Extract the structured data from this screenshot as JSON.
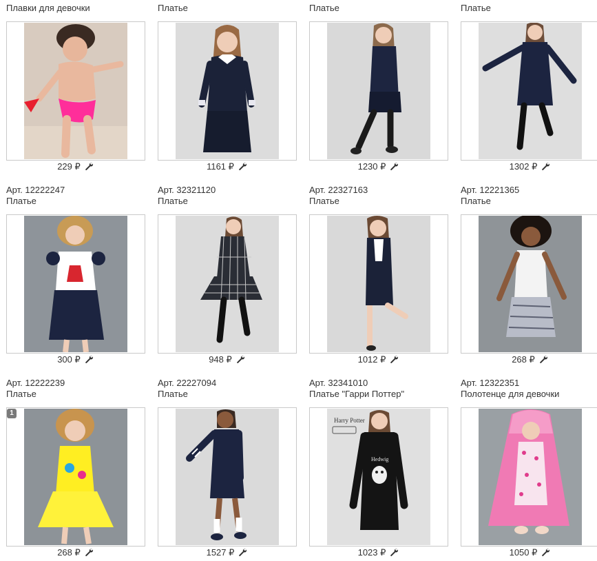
{
  "products": [
    {
      "art": "",
      "title": "Плавки для девочки",
      "price": "229 ₽",
      "badge": ""
    },
    {
      "art": "",
      "title": "Платье",
      "price": "1161 ₽",
      "badge": ""
    },
    {
      "art": "",
      "title": "Платье",
      "price": "1230 ₽",
      "badge": ""
    },
    {
      "art": "",
      "title": "Платье",
      "price": "1302 ₽",
      "badge": ""
    },
    {
      "art": "Арт. 12222247",
      "title": "Платье",
      "price": "300 ₽",
      "badge": ""
    },
    {
      "art": "Арт. 32321120",
      "title": "Платье",
      "price": "948 ₽",
      "badge": ""
    },
    {
      "art": "Арт. 22327163",
      "title": "Платье",
      "price": "1012 ₽",
      "badge": ""
    },
    {
      "art": "Арт. 12221365",
      "title": "Платье",
      "price": "268 ₽",
      "badge": ""
    },
    {
      "art": "Арт. 12222239",
      "title": "Платье",
      "price": "268 ₽",
      "badge": "1"
    },
    {
      "art": "Арт. 22227094",
      "title": "Платье",
      "price": "1527 ₽",
      "badge": ""
    },
    {
      "art": "Арт. 32341010",
      "title": "Платье \"Гарри Поттер\"",
      "price": "1023 ₽",
      "badge": ""
    },
    {
      "art": "Арт. 12322351",
      "title": "Полотенце для девочки",
      "price": "1050 ₽",
      "badge": ""
    }
  ],
  "icons": {
    "admin": "wrench-icon"
  }
}
